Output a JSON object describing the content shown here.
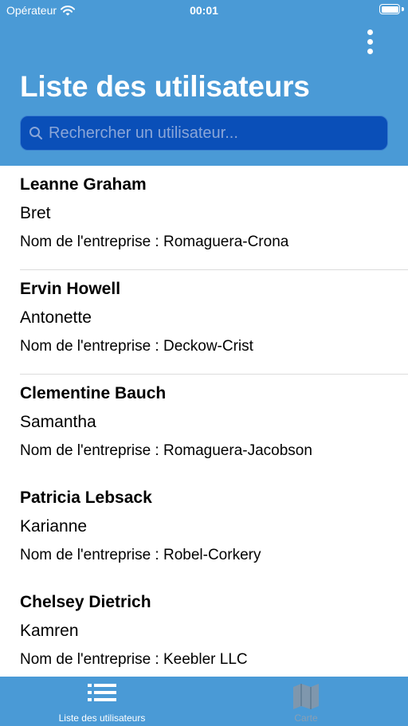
{
  "status_bar": {
    "carrier": "Opérateur",
    "time": "00:01",
    "battery_level": 1.0
  },
  "header": {
    "title": "Liste des utilisateurs",
    "more_icon": "more-vertical-icon",
    "background_color": "#4a9ad6"
  },
  "search": {
    "placeholder": "Rechercher un utilisateur...",
    "value": "",
    "icon": "search-icon"
  },
  "users": [
    {
      "name": "Leanne Graham",
      "username": "Bret",
      "company": "Nom de l'entreprise : Romaguera-Crona"
    },
    {
      "name": "Ervin Howell",
      "username": "Antonette",
      "company": "Nom de l'entreprise : Deckow-Crist"
    },
    {
      "name": "Clementine Bauch",
      "username": "Samantha",
      "company": "Nom de l'entreprise : Romaguera-Jacobson"
    },
    {
      "name": "Patricia Lebsack",
      "username": "Karianne",
      "company": "Nom de l'entreprise : Robel-Corkery"
    },
    {
      "name": "Chelsey Dietrich",
      "username": "Kamren",
      "company": "Nom de l'entreprise : Keebler LLC"
    }
  ],
  "tab_bar": {
    "tabs": [
      {
        "label": "Liste des utilisateurs",
        "icon": "list-icon",
        "active": true
      },
      {
        "label": "Carte",
        "icon": "map-icon",
        "active": false
      }
    ]
  }
}
